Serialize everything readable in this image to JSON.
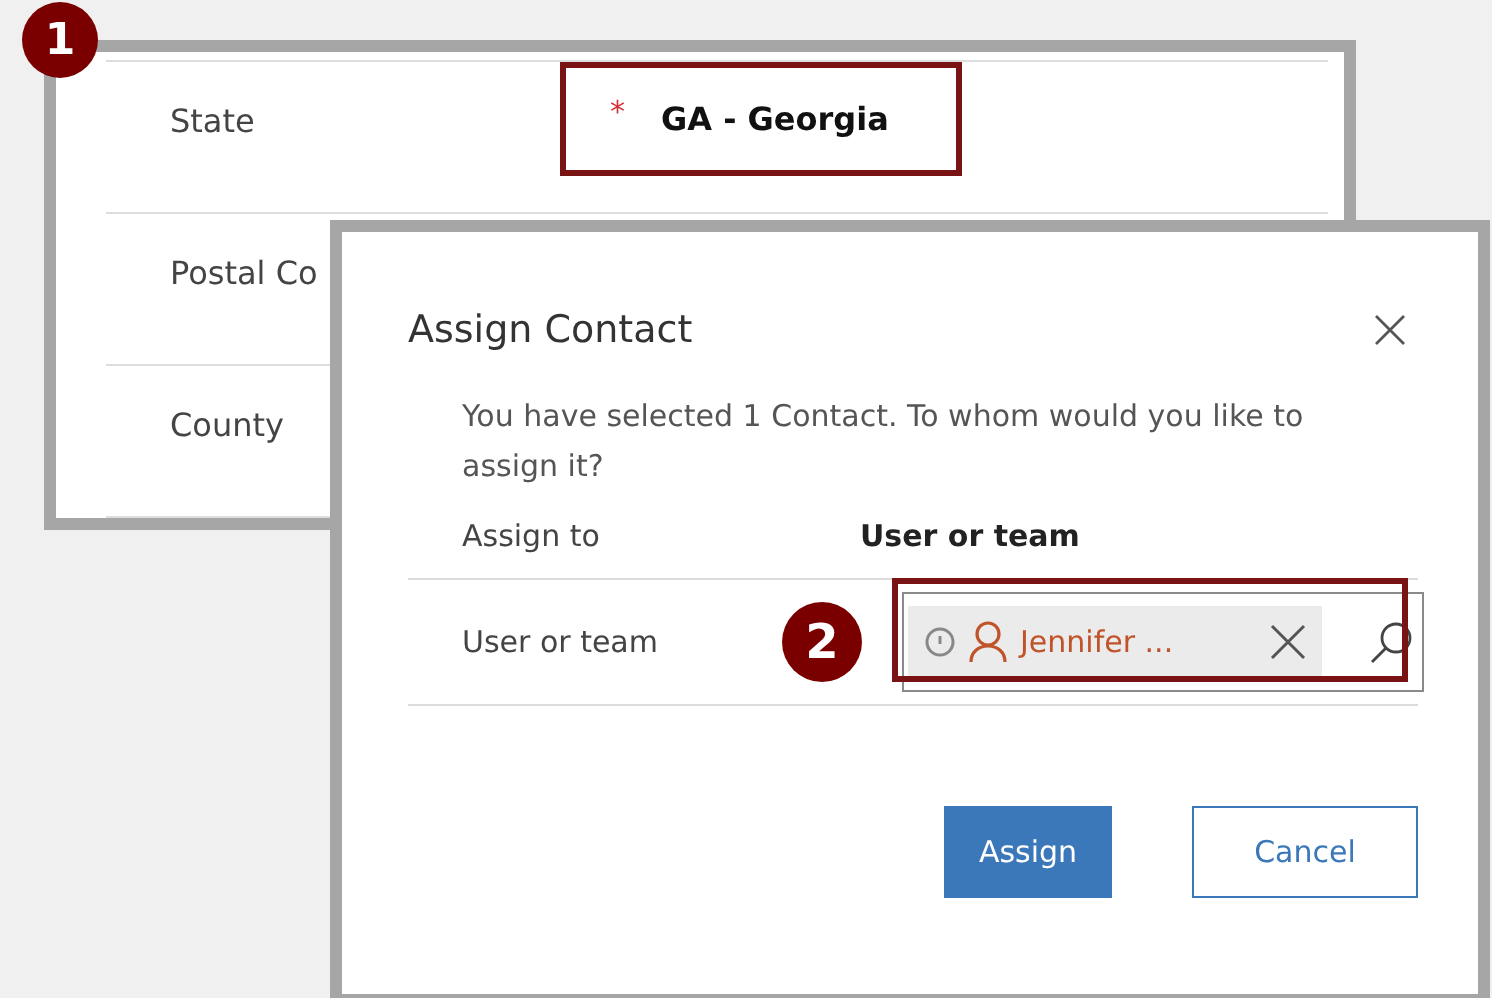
{
  "form": {
    "callout": "1",
    "fields": [
      {
        "label": "State",
        "required_mark": "*",
        "value": "GA - Georgia",
        "highlighted": true
      },
      {
        "label": "Postal Co"
      },
      {
        "label": "County"
      }
    ]
  },
  "dialog": {
    "title": "Assign Contact",
    "message": "You have selected 1 Contact. To whom would you like to assign it?",
    "assign_to_label": "Assign to",
    "assign_to_value": "User or team",
    "lookup": {
      "label": "User or team",
      "tag": "Jennifer ...",
      "highlighted": true,
      "callout": "2"
    },
    "buttons": [
      {
        "label": "Assign",
        "kind": "primary"
      },
      {
        "label": "Cancel",
        "kind": "secondary"
      }
    ]
  }
}
